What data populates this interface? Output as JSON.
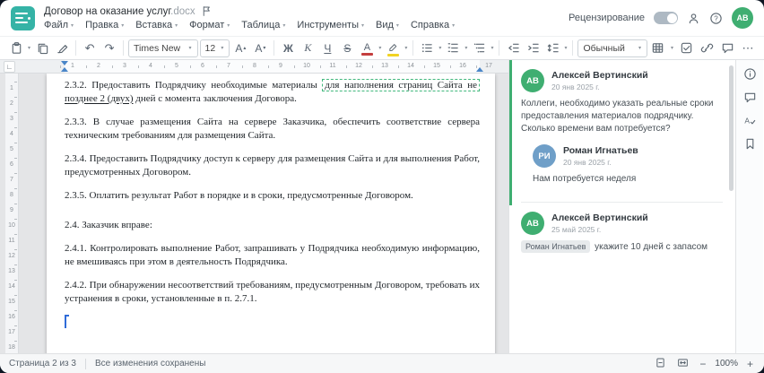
{
  "window": {
    "title": "Договор на оказание услуг",
    "title_ext": ".docx"
  },
  "colors": {
    "brand_teal": "#35b3a6",
    "accent_green": "#3fae71",
    "avatar_roman_blue": "#6f9fc8",
    "ruler_marker_blue": "#4a86c8",
    "font_color_bar": "#c43e3e",
    "highlight_bar": "#f2d323"
  },
  "icons": {
    "caret": "▾",
    "up": "▴",
    "down": "▾",
    "undo": "↶",
    "redo": "↷",
    "more": "⋯",
    "minus": "−",
    "plus": "+",
    "tab_selector": "∟",
    "help": "?"
  },
  "header": {
    "menus": [
      "Файл",
      "Правка",
      "Вставка",
      "Формат",
      "Таблица",
      "Инструменты",
      "Вид",
      "Справка"
    ],
    "review_label": "Рецензирование",
    "avatar_initials": "АВ"
  },
  "toolbar": {
    "font_name": "Times New",
    "font_size": "12",
    "font_letter": "А",
    "bold": "Ж",
    "italic": "К",
    "underline": "Ч",
    "strike": "S",
    "style_name": "Обычный"
  },
  "ruler": {
    "h_numbers": [
      1,
      2,
      3,
      4,
      5,
      6,
      7,
      8,
      9,
      10,
      11,
      12,
      13,
      14,
      15,
      16,
      17
    ],
    "v_numbers": [
      1,
      2,
      3,
      4,
      5,
      6,
      7,
      8,
      9,
      10,
      11,
      12,
      13,
      14,
      15,
      16,
      17,
      18
    ]
  },
  "document": {
    "paragraphs": [
      {
        "segments": [
          {
            "t": "2.3.2. Предоставить Подрядчику необходимые материалы ",
            "s": "n"
          },
          {
            "t": "для наполнения страниц Сайта не",
            "s": "box"
          },
          {
            "t": " ",
            "s": "n"
          },
          {
            "t": "позднее 2 (двух)",
            "s": "ins"
          },
          {
            "t": " дней с момента заключения Договора.",
            "s": "n"
          }
        ]
      },
      {
        "segments": [
          {
            "t": "2.3.3. В случае размещения Сайта на сервере Заказчика, обеспечить соответствие сервера техническим требованиям для размещения Сайта.",
            "s": "n"
          }
        ]
      },
      {
        "segments": [
          {
            "t": "2.3.4. Предоставить Подрядчику доступ к серверу для размещения Сайта и для выполнения Работ, предусмотренных Договором.",
            "s": "n"
          }
        ]
      },
      {
        "segments": [
          {
            "t": "2.3.5. Оплатить результат Работ в порядке и в сроки, предусмотренные Договором.",
            "s": "n"
          }
        ]
      },
      {
        "extra_gap": true,
        "segments": [
          {
            "t": "2.4. Заказчик вправе:",
            "s": "n"
          }
        ]
      },
      {
        "segments": [
          {
            "t": "2.4.1. Контролировать выполнение Работ, запрашивать у Подрядчика необходимую информацию, не вмешиваясь при этом в деятельность Подрядчика.",
            "s": "n"
          }
        ]
      },
      {
        "segments": [
          {
            "t": "2.4.2. При обнаружении несоответствий требованиям, предусмотренным Договором, требовать их устранения в сроки, установленные в п. 2.7.1.",
            "s": "n"
          }
        ]
      }
    ]
  },
  "comments": {
    "threads": [
      {
        "active": true,
        "items": [
          {
            "initials": "АВ",
            "color": "#3fae71",
            "author": "Алексей Вертинский",
            "date": "20 янв 2025 г.",
            "text": "Коллеги, необходимо указать реальные сроки предоставления материалов подрядчику. Сколько времени вам потребуется?",
            "reply": false
          },
          {
            "initials": "РИ",
            "color": "#6f9fc8",
            "author": "Роман Игнатьев",
            "date": "20 янв 2025 г.",
            "text": "Нам потребуется неделя",
            "reply": true
          }
        ]
      },
      {
        "active": false,
        "items": [
          {
            "initials": "АВ",
            "color": "#3fae71",
            "author": "Алексей Вертинский",
            "date": "25 май 2025 г.",
            "mention": "Роман Игнатьев",
            "text": " укажите 10 дней с запасом",
            "reply": false
          }
        ]
      }
    ]
  },
  "status_bar": {
    "page": "Страница 2 из 3",
    "saved": "Все изменения сохранены",
    "zoom": "100%"
  }
}
